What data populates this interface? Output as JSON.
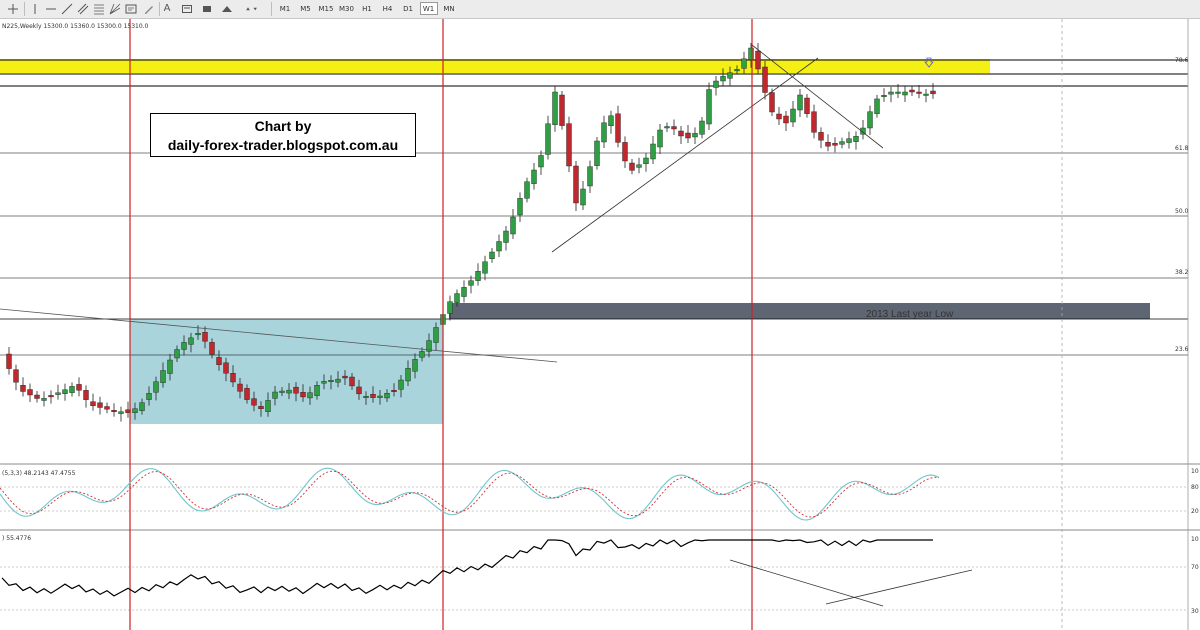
{
  "toolbar": {
    "timeframes": [
      {
        "label": "M1",
        "active": false
      },
      {
        "label": "M5",
        "active": false
      },
      {
        "label": "M15",
        "active": false
      },
      {
        "label": "M30",
        "active": false
      },
      {
        "label": "H1",
        "active": false
      },
      {
        "label": "H4",
        "active": false
      },
      {
        "label": "D1",
        "active": false
      },
      {
        "label": "W1",
        "active": true
      },
      {
        "label": "MN",
        "active": false
      }
    ],
    "text_tool_label": "A",
    "icons": [
      "crosshair-icon",
      "vertical-line-icon",
      "horizontal-line-icon",
      "trendline-icon",
      "channel-icon",
      "fibonacci-icon",
      "text-tool-icon",
      "label-tool-icon",
      "rectangle-icon",
      "arrow-tool-icon",
      "shapes-dropdown-icon"
    ]
  },
  "chart_header": {
    "symbol_info": "N225,Weekly  15300.0 15360.0 15300.0 15310.0"
  },
  "annotations": {
    "watermark_line1": "Chart by",
    "watermark_line2": "daily-forex-trader.blogspot.com.au",
    "last_year_low": "2013 Last year Low"
  },
  "fib_levels": [
    "78.6",
    "61.8",
    "50.0",
    "38.2",
    "23.6"
  ],
  "stochastic": {
    "label": "(5,3,3) 48.2143 47.4755",
    "scale": [
      "10",
      "80",
      "20"
    ]
  },
  "rsi": {
    "label": ") 55.4776",
    "scale": [
      "10",
      "70",
      "30"
    ]
  },
  "colors": {
    "bull": "#2ea043",
    "bear": "#c0282d",
    "highlight_band": "#f5f014",
    "range_box": "#a9d4dc",
    "low_zone": "#5f6673",
    "vertical_marker": "#cc2222",
    "stoch_main": "#6fc6cc",
    "stoch_signal": "#d03030"
  }
}
